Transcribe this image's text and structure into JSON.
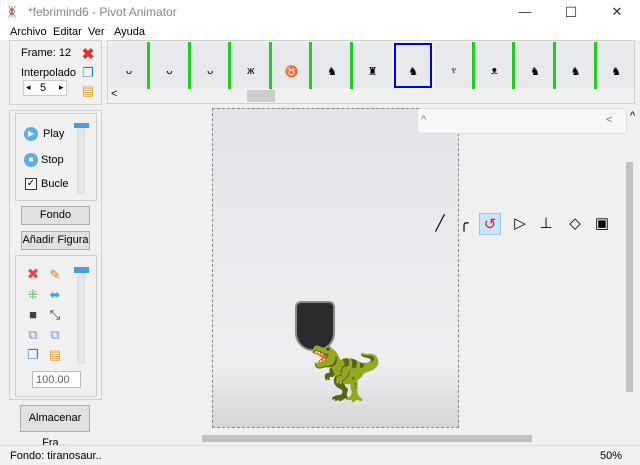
{
  "window": {
    "title": "*febrimind6 - Pivot Animator",
    "app_icon": "stick-figure-icon",
    "minimize": "—",
    "maximize": "☐",
    "close": "✕"
  },
  "menu": [
    "Archivo",
    "Editar",
    "Ver",
    "Ayuda"
  ],
  "frame_panel": {
    "frame_label": "Frame: 12",
    "interpolate_label": "Interpolado",
    "interpolate_value": "5",
    "dec": "◂",
    "inc": "▸"
  },
  "timeline": {
    "frames": [
      "ᴗ",
      "ᴗ",
      "ᴗ",
      "ж",
      "♉",
      "♞",
      "♜",
      "♞",
      "♆",
      "ᴥ",
      "♞",
      "♞",
      "♞"
    ],
    "selected_index": 7,
    "scroll_left": "<"
  },
  "playback": {
    "play": "Play",
    "stop": "Stop",
    "loop": "Bucle",
    "loop_checked": true
  },
  "buttons": {
    "background": "Fondo",
    "add_figure": "Añadir Figura",
    "store_frame": "Almacenar Fra..."
  },
  "figure_tools": {
    "scale_value": "100.00"
  },
  "status": {
    "left": "Fondo: tiranosaur..",
    "zoom": "50%"
  },
  "toolbar": {
    "collapse": "^",
    "expand": "<",
    "right_caret": "^"
  },
  "colors": {
    "accent": "#0000e0",
    "frame_marker": "#22cc22"
  }
}
